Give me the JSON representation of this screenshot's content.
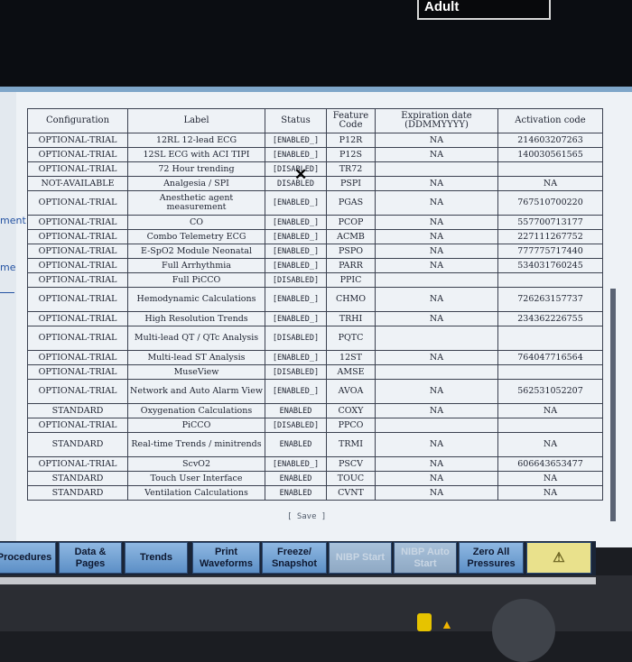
{
  "patient_category": "Adult",
  "side_labels": [
    "ment",
    "me"
  ],
  "table": {
    "headers": [
      "Configuration",
      "Label",
      "Status",
      "Feature Code",
      "Expiration date (DDMMYYYY)",
      "Activation code"
    ],
    "rows": [
      [
        "OPTIONAL-TRIAL",
        "12RL 12-lead ECG",
        "[ENABLED_]",
        "P12R",
        "NA",
        "214603207263"
      ],
      [
        "OPTIONAL-TRIAL",
        "12SL ECG with ACI TIPI",
        "[ENABLED_]",
        "P12S",
        "NA",
        "140030561565"
      ],
      [
        "OPTIONAL-TRIAL",
        "72 Hour trending",
        "[DISABLED]",
        "TR72",
        "",
        ""
      ],
      [
        "NOT-AVAILABLE",
        "Analgesia / SPI",
        "DISABLED",
        "PSPI",
        "NA",
        "NA"
      ],
      [
        "OPTIONAL-TRIAL",
        "Anesthetic agent measurement",
        "[ENABLED_]",
        "PGAS",
        "NA",
        "767510700220"
      ],
      [
        "OPTIONAL-TRIAL",
        "CO",
        "[ENABLED_]",
        "PCOP",
        "NA",
        "557700713177"
      ],
      [
        "OPTIONAL-TRIAL",
        "Combo Telemetry ECG",
        "[ENABLED_]",
        "ACMB",
        "NA",
        "227111267752"
      ],
      [
        "OPTIONAL-TRIAL",
        "E-SpO2 Module Neonatal",
        "[ENABLED_]",
        "PSPO",
        "NA",
        "777775717440"
      ],
      [
        "OPTIONAL-TRIAL",
        "Full Arrhythmia",
        "[ENABLED_]",
        "PARR",
        "NA",
        "534031760245"
      ],
      [
        "OPTIONAL-TRIAL",
        "Full PiCCO",
        "[DISABLED]",
        "PPIC",
        "",
        ""
      ],
      [
        "OPTIONAL-TRIAL",
        "Hemodynamic Calculations",
        "[ENABLED_]",
        "CHMO",
        "NA",
        "726263157737"
      ],
      [
        "OPTIONAL-TRIAL",
        "High Resolution Trends",
        "[ENABLED_]",
        "TRHI",
        "NA",
        "234362226755"
      ],
      [
        "OPTIONAL-TRIAL",
        "Multi-lead QT / QTc Analysis",
        "[DISABLED]",
        "PQTC",
        "",
        ""
      ],
      [
        "OPTIONAL-TRIAL",
        "Multi-lead ST Analysis",
        "[ENABLED_]",
        "12ST",
        "NA",
        "764047716564"
      ],
      [
        "OPTIONAL-TRIAL",
        "MuseView",
        "[DISABLED]",
        "AMSE",
        "",
        ""
      ],
      [
        "OPTIONAL-TRIAL",
        "Network and Auto Alarm View",
        "[ENABLED_]",
        "AVOA",
        "NA",
        "562531052207"
      ],
      [
        "STANDARD",
        "Oxygenation Calculations",
        "ENABLED",
        "COXY",
        "NA",
        "NA"
      ],
      [
        "OPTIONAL-TRIAL",
        "PiCCO",
        "[DISABLED]",
        "PPCO",
        "",
        ""
      ],
      [
        "STANDARD",
        "Real-time Trends / minitrends",
        "ENABLED",
        "TRMI",
        "NA",
        "NA"
      ],
      [
        "OPTIONAL-TRIAL",
        "ScvO2",
        "[ENABLED_]",
        "PSCV",
        "NA",
        "606643653477"
      ],
      [
        "STANDARD",
        "Touch User Interface",
        "ENABLED",
        "TOUC",
        "NA",
        "NA"
      ],
      [
        "STANDARD",
        "Ventilation Calculations",
        "ENABLED",
        "CVNT",
        "NA",
        "NA"
      ]
    ]
  },
  "save_label": "[ Save ]",
  "x_mark": "✕",
  "softkeys": [
    {
      "label": "Procedures"
    },
    {
      "label": "Data & Pages"
    },
    {
      "label": "Trends"
    },
    {
      "label": "Print Waveforms"
    },
    {
      "label": "Freeze/ Snapshot"
    },
    {
      "label": "NIBP Start"
    },
    {
      "label": "NIBP Auto Start"
    },
    {
      "label": "Zero All Pressures"
    },
    {
      "label": "alarm-bell-icon"
    }
  ],
  "colors": {
    "accent": "#7fa6c9",
    "softkey": "#6f9fd2",
    "alarm_key": "#e9e18c"
  }
}
